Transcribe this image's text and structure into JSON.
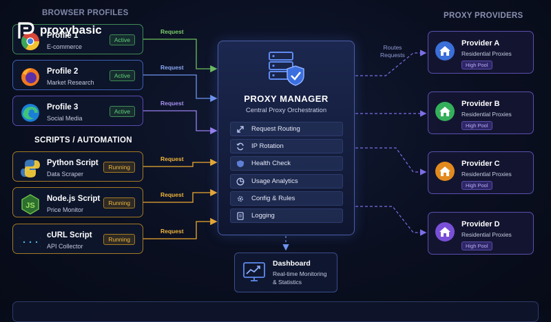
{
  "brand": {
    "name": "proxybasic"
  },
  "sections": {
    "browser_profiles": "BROWSER PROFILES",
    "scripts": "SCRIPTS / AUTOMATION",
    "providers": "PROXY PROVIDERS"
  },
  "profiles": [
    {
      "title": "Profile 1",
      "sub": "E-commerce",
      "status": "Active",
      "icon": "chrome-icon"
    },
    {
      "title": "Profile 2",
      "sub": "Market Research",
      "status": "Active",
      "icon": "firefox-icon"
    },
    {
      "title": "Profile 3",
      "sub": "Social Media",
      "status": "Active",
      "icon": "edge-icon"
    }
  ],
  "scripts": [
    {
      "title": "Python Script",
      "sub": "Data Scraper",
      "status": "Running",
      "icon": "python-icon"
    },
    {
      "title": "Node.js Script",
      "sub": "Price Monitor",
      "status": "Running",
      "icon": "nodejs-icon"
    },
    {
      "title": "cURL Script",
      "sub": "API Collector",
      "status": "Running",
      "icon": "curl-icon"
    }
  ],
  "request_label": "Request",
  "routes_label_line1": "Routes",
  "routes_label_line2": "Requests",
  "manager": {
    "title": "PROXY MANAGER",
    "subtitle": "Central Proxy Orchestration",
    "features": [
      {
        "label": "Request Routing",
        "icon": "routing-icon"
      },
      {
        "label": "IP Rotation",
        "icon": "rotation-icon"
      },
      {
        "label": "Health Check",
        "icon": "shield-icon"
      },
      {
        "label": "Usage Analytics",
        "icon": "pie-chart-icon"
      },
      {
        "label": "Config & Rules",
        "icon": "gear-icon"
      },
      {
        "label": "Logging",
        "icon": "log-icon"
      }
    ]
  },
  "dashboard": {
    "title": "Dashboard",
    "line1": "Real-time Monitoring",
    "line2": "& Statistics"
  },
  "providers": [
    {
      "title": "Provider A",
      "sub": "Residential Proxies",
      "pill": "High Pool",
      "color": "#3b6fd9"
    },
    {
      "title": "Provider B",
      "sub": "Residential Proxies",
      "pill": "High Pool",
      "color": "#34b05a"
    },
    {
      "title": "Provider C",
      "sub": "Residential Proxies",
      "pill": "High Pool",
      "color": "#e38a1e"
    },
    {
      "title": "Provider D",
      "sub": "Residential Proxies",
      "pill": "High Pool",
      "color": "#7a4fd8"
    }
  ],
  "colors": {
    "active": "#5fd37a",
    "running": "#f1b940",
    "accent": "#4b5ea8",
    "provider_border": "#5a4fb0"
  }
}
